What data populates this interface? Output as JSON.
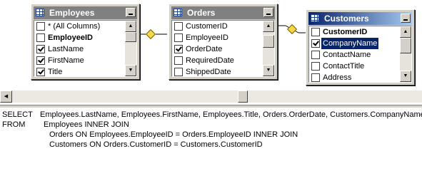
{
  "tables": [
    {
      "name": "Employees",
      "columns": [
        {
          "label": "* (All Columns)",
          "checked": false,
          "bold": false,
          "selected": false
        },
        {
          "label": "EmployeeID",
          "checked": false,
          "bold": true,
          "selected": false
        },
        {
          "label": "LastName",
          "checked": true,
          "bold": false,
          "selected": false
        },
        {
          "label": "FirstName",
          "checked": true,
          "bold": false,
          "selected": false
        },
        {
          "label": "Title",
          "checked": true,
          "bold": false,
          "selected": false
        }
      ]
    },
    {
      "name": "Orders",
      "columns": [
        {
          "label": "CustomerID",
          "checked": false,
          "bold": false,
          "selected": false
        },
        {
          "label": "EmployeeID",
          "checked": false,
          "bold": false,
          "selected": false
        },
        {
          "label": "OrderDate",
          "checked": true,
          "bold": false,
          "selected": false
        },
        {
          "label": "RequiredDate",
          "checked": false,
          "bold": false,
          "selected": false
        },
        {
          "label": "ShippedDate",
          "checked": false,
          "bold": false,
          "selected": false
        }
      ]
    },
    {
      "name": "Customers",
      "columns": [
        {
          "label": "CustomerID",
          "checked": false,
          "bold": true,
          "selected": false
        },
        {
          "label": "CompanyName",
          "checked": true,
          "bold": false,
          "selected": true
        },
        {
          "label": "ContactName",
          "checked": false,
          "bold": false,
          "selected": false
        },
        {
          "label": "ContactTitle",
          "checked": false,
          "bold": false,
          "selected": false
        },
        {
          "label": "Address",
          "checked": false,
          "bold": false,
          "selected": false
        }
      ]
    }
  ],
  "sql": {
    "select_kw": "SELECT",
    "select_cols": "Employees.LastName, Employees.FirstName, Employees.Title, Orders.OrderDate, Customers.CompanyName",
    "from_kw": "FROM",
    "from_line1": "Employees INNER JOIN",
    "from_line2": "Orders ON Employees.EmployeeID = Orders.EmployeeID INNER JOIN",
    "from_line3": "Customers ON Orders.CustomerID = Customers.CustomerID"
  },
  "icons": {
    "table": "table-grid-icon",
    "minimize": "minimize-icon",
    "join": "join-key-icon",
    "scroll_up": "scroll-up-arrow-icon",
    "scroll_down": "scroll-down-arrow-icon",
    "scroll_left": "scroll-left-arrow-icon",
    "scroll_right": "scroll-right-arrow-icon"
  },
  "colors": {
    "active_title": "#0a246a",
    "inactive_title": "#808080",
    "selection": "#0a246a"
  }
}
